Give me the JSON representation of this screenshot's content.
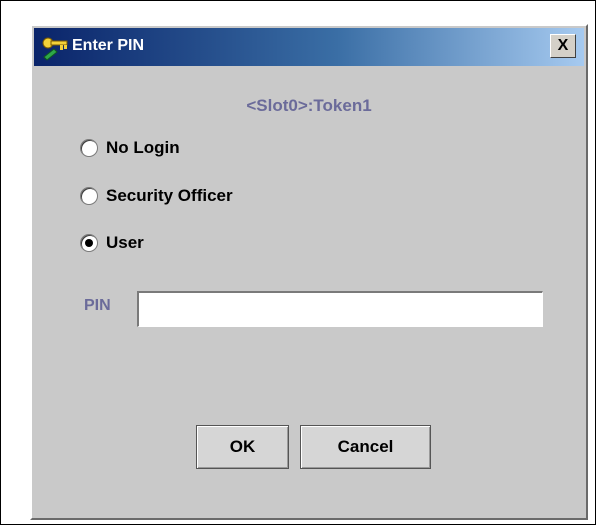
{
  "window": {
    "title": "Enter PIN",
    "close_symbol": "X",
    "icon": "key-icon"
  },
  "token": {
    "label": "<Slot0>:Token1"
  },
  "login_options": [
    {
      "label": "No Login",
      "selected": false
    },
    {
      "label": "Security Officer",
      "selected": false
    },
    {
      "label": "User",
      "selected": true
    }
  ],
  "pin": {
    "label": "PIN",
    "value": "",
    "placeholder": ""
  },
  "buttons": {
    "ok_label": "OK",
    "cancel_label": "Cancel"
  },
  "colors": {
    "title_gradient_start": "#0a246a",
    "title_gradient_end": "#a6caf0",
    "accent_label": "#6b6b9a",
    "dialog_bg": "#c9c9c9"
  }
}
